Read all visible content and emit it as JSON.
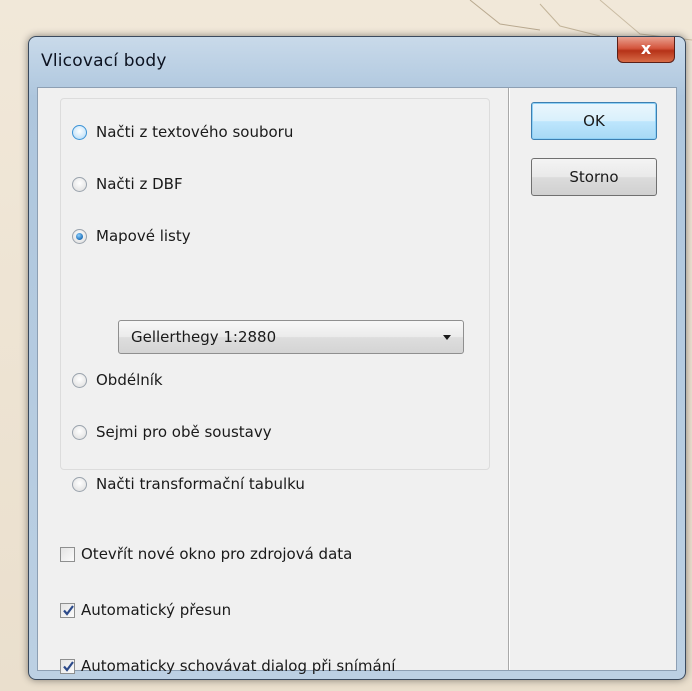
{
  "dialog": {
    "title": "Vlicovací body",
    "close_label": "x"
  },
  "source_options": [
    {
      "label": "Načti z textového souboru",
      "selected": false
    },
    {
      "label": "Načti z DBF",
      "selected": false
    },
    {
      "label": "Mapové listy",
      "selected": true
    },
    {
      "label": "Obdélník",
      "selected": false
    },
    {
      "label": "Sejmi pro obě soustavy",
      "selected": false
    },
    {
      "label": "Načti transformační tabulku",
      "selected": false
    }
  ],
  "sheet_select": {
    "value": "Gellerthegy 1:2880"
  },
  "options": [
    {
      "label": "Otevřít nové okno pro zdrojová data",
      "checked": false
    },
    {
      "label": "Automatický přesun",
      "checked": true
    },
    {
      "label": "Automaticky schovávat dialog při snímání",
      "checked": true
    }
  ],
  "buttons": {
    "ok_label": "OK",
    "cancel_label": "Storno"
  },
  "colors": {
    "accent": "#3c7fb1",
    "close": "#c4401f"
  }
}
